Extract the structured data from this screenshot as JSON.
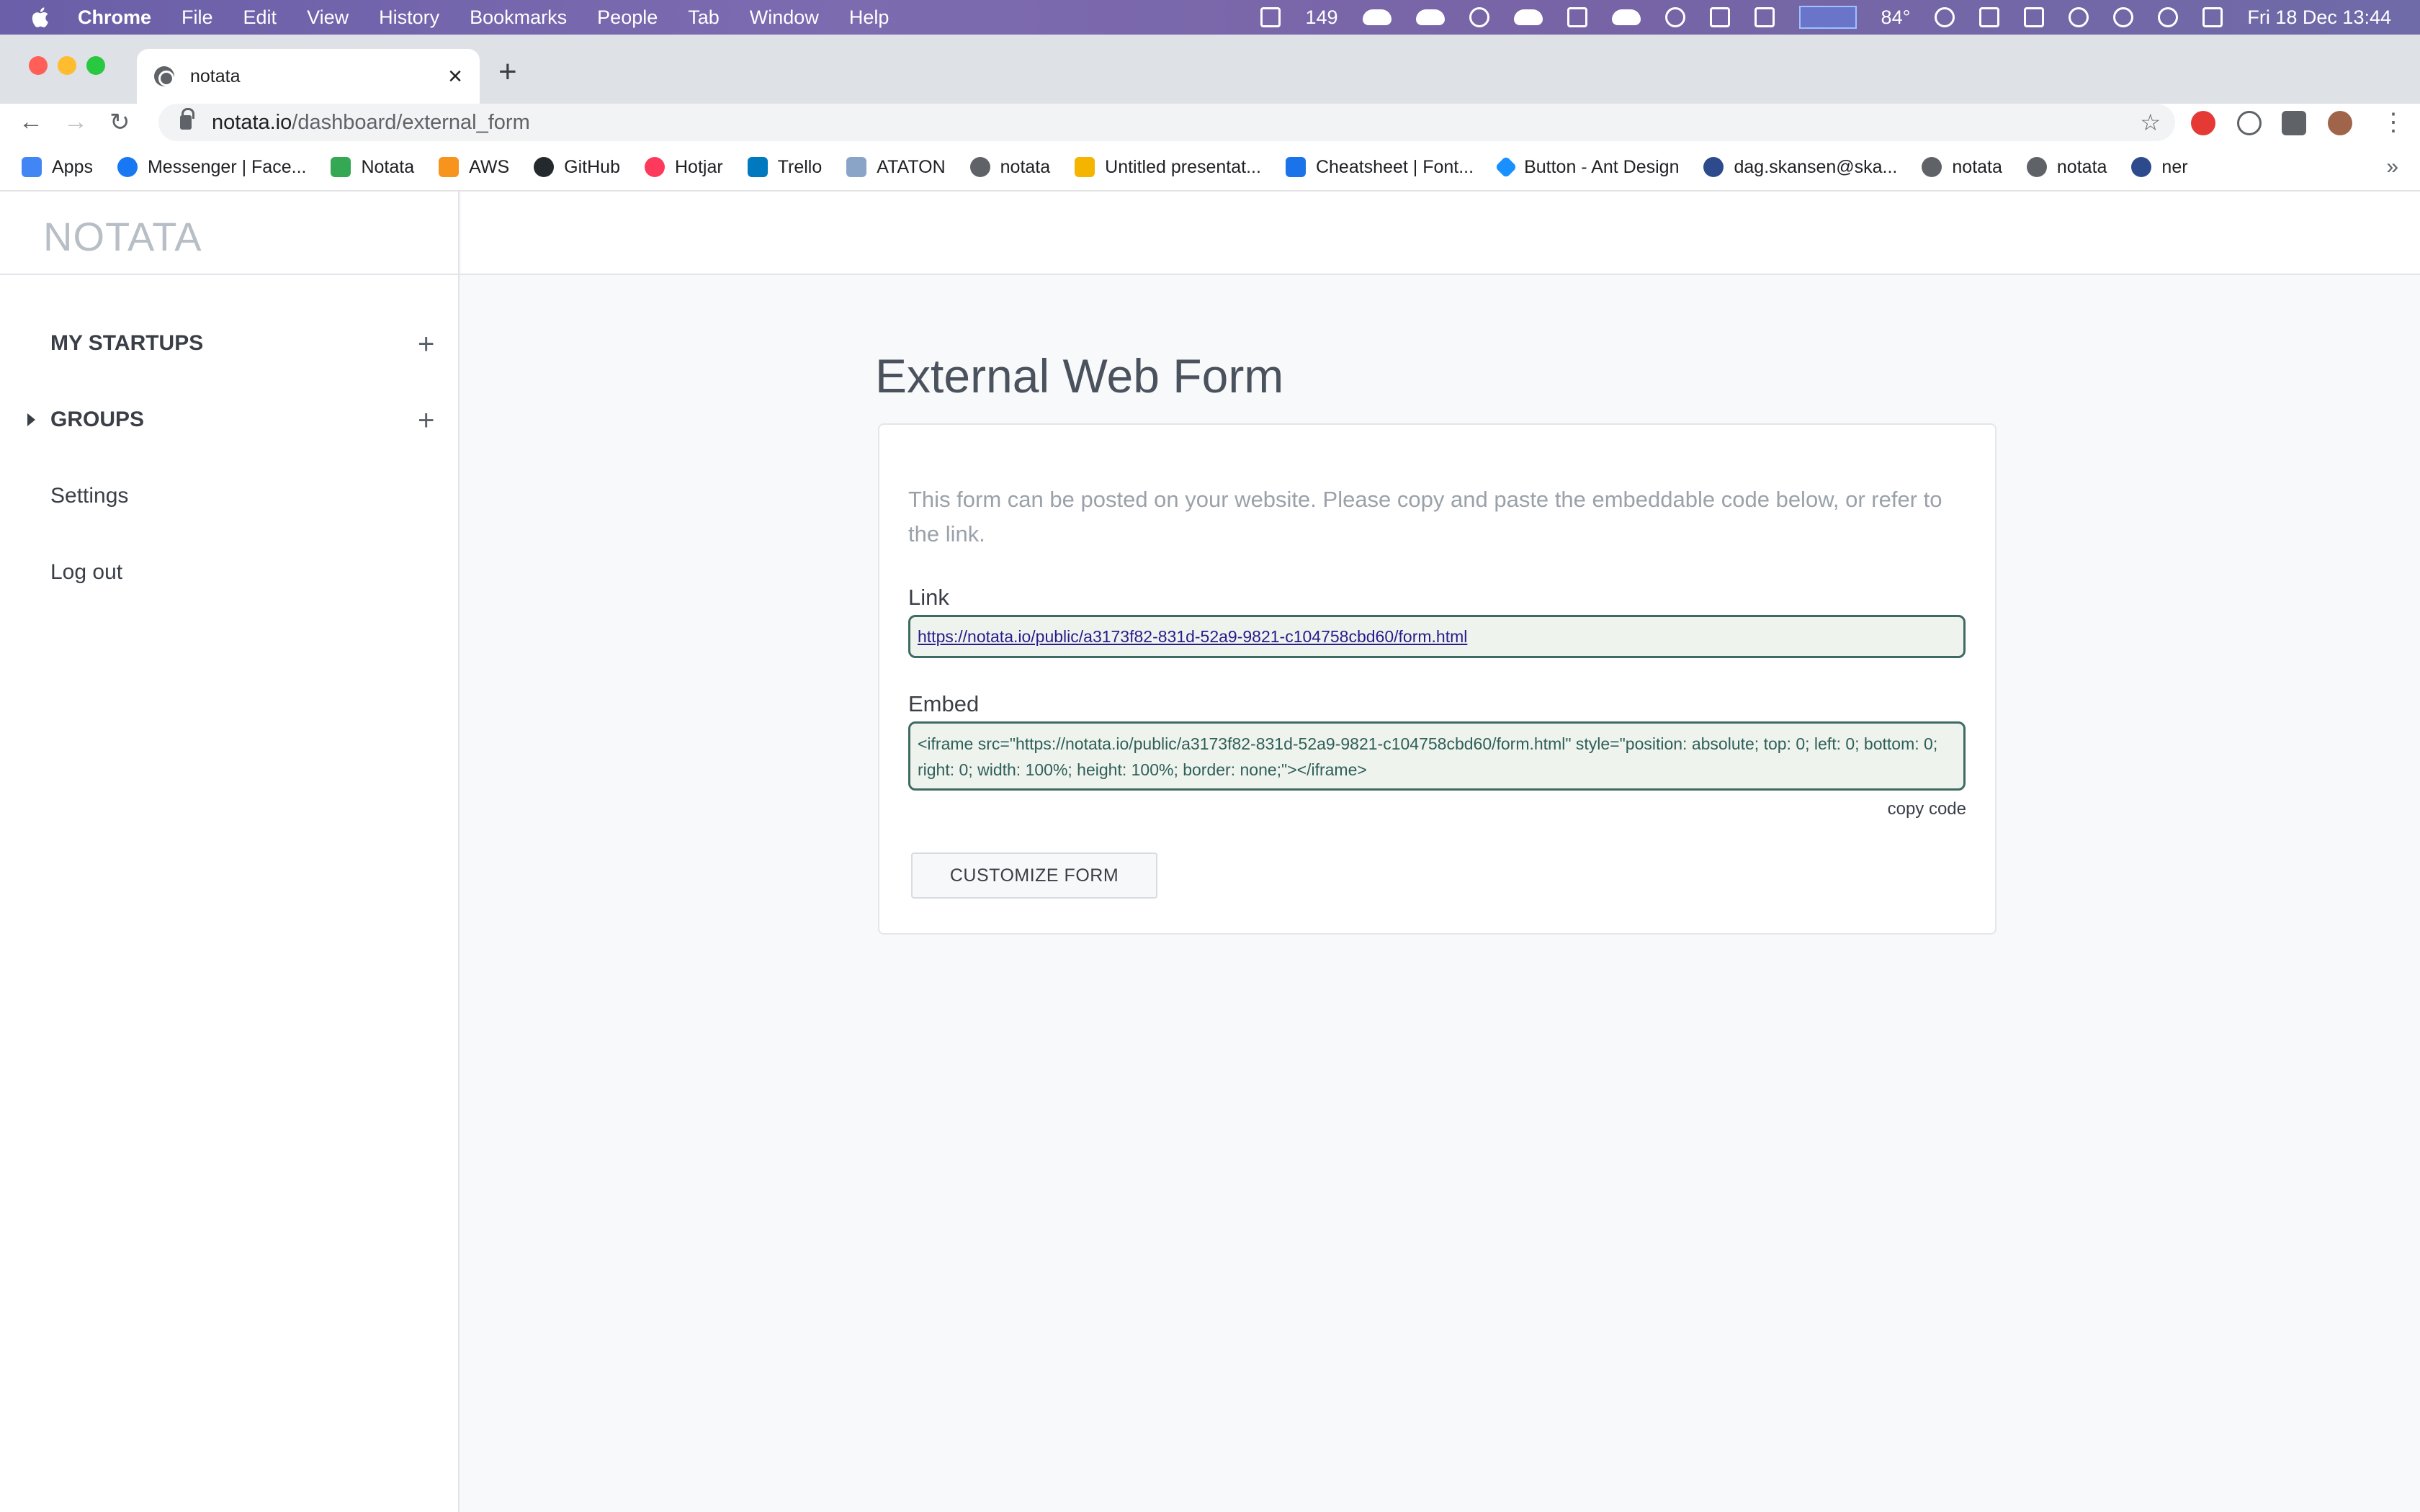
{
  "menubar": {
    "app_name": "Chrome",
    "menus": [
      "File",
      "Edit",
      "View",
      "History",
      "Bookmarks",
      "People",
      "Tab",
      "Window",
      "Help"
    ],
    "badge_count": "149",
    "temperature": "84°",
    "datetime": "Fri 18 Dec  13:44"
  },
  "tab": {
    "title": "notata",
    "close": "×",
    "new_tab": "+"
  },
  "toolbar": {
    "url_host": "notata.io",
    "url_path": "/dashboard/external_form"
  },
  "bookmarks": {
    "items": [
      {
        "label": "Apps",
        "color": "#4285f4"
      },
      {
        "label": "Messenger | Face...",
        "color": "#1877f2"
      },
      {
        "label": "Notata",
        "color": "#34a853"
      },
      {
        "label": "AWS",
        "color": "#f7941d"
      },
      {
        "label": "GitHub",
        "color": "#24292e"
      },
      {
        "label": "Hotjar",
        "color": "#fd3a5c"
      },
      {
        "label": "Trello",
        "color": "#0079bf"
      },
      {
        "label": "ATATON",
        "color": "#8aa4c8"
      },
      {
        "label": "notata",
        "color": "#5f6368"
      },
      {
        "label": "Untitled presentat...",
        "color": "#f4b400"
      },
      {
        "label": "Cheatsheet | Font...",
        "color": "#1a73e8"
      },
      {
        "label": "Button - Ant Design",
        "color": "#1890ff"
      },
      {
        "label": "dag.skansen@ska...",
        "color": "#2c4a8c"
      },
      {
        "label": "notata",
        "color": "#5f6368"
      },
      {
        "label": "notata",
        "color": "#5f6368"
      },
      {
        "label": "ner",
        "color": "#2c4a8c"
      }
    ],
    "more": "»"
  },
  "app": {
    "logo": "NOTATA",
    "sidebar": {
      "my_startups": "MY STARTUPS",
      "groups": "GROUPS",
      "settings": "Settings",
      "logout": "Log out",
      "plus": "+"
    },
    "page_title": "External Web Form",
    "description": "This form can be posted on your website. Please copy and paste the embeddable code below, or refer to the link.",
    "link_label": "Link",
    "link_value": "https://notata.io/public/a3173f82-831d-52a9-9821-c104758cbd60/form.html",
    "embed_label": "Embed",
    "embed_value": "<iframe src=\"https://notata.io/public/a3173f82-831d-52a9-9821-c104758cbd60/form.html\" style=\"position: absolute; top: 0; left: 0; bottom: 0; right: 0; width: 100%; height: 100%; border: none;\"></iframe>",
    "copy_code": "copy code",
    "customize_button": "CUSTOMIZE FORM"
  }
}
